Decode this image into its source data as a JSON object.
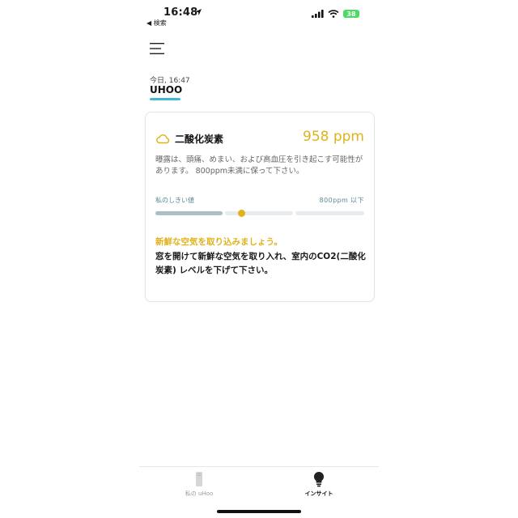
{
  "status_bar": {
    "time": "16:48",
    "back_label": "◀ 検索",
    "battery": "38"
  },
  "header": {
    "timestamp": "今日, 16:47",
    "device_name": "UHOO"
  },
  "card": {
    "metric_name": "二酸化炭素",
    "metric_value": "958 ppm",
    "description": "曝露は、頭痛、めまい、および高血圧を引き起こす可能性があります。 800ppm未満に保って下さい。",
    "threshold_label": "私のしきい値",
    "threshold_value": "800ppm 以下",
    "advice_title": "新鮮な空気を取り込みましょう。",
    "advice_body": "窓を開けて新鮮な空気を取り入れ、室内のCO2(二酸化炭素) レベルを下げて下さい。"
  },
  "tabs": [
    {
      "label": "私の uHoo",
      "icon": "device-icon",
      "active": false
    },
    {
      "label": "インサイト",
      "icon": "lightbulb-icon",
      "active": true
    }
  ],
  "colors": {
    "accent_yellow": "#e0b21c",
    "accent_blue": "#3fb6d6",
    "battery_green": "#4cd964"
  }
}
